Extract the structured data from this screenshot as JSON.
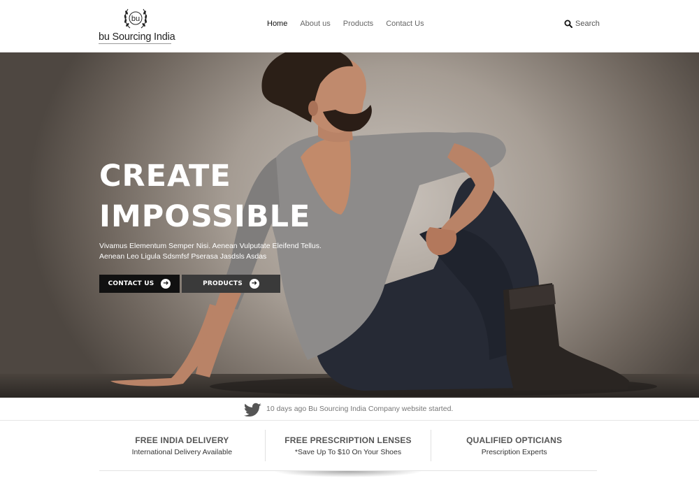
{
  "brand": {
    "emblem_text": "bu",
    "name": "bu Sourcing India"
  },
  "nav": {
    "items": [
      {
        "label": "Home",
        "active": true
      },
      {
        "label": "About us",
        "active": false
      },
      {
        "label": "Products",
        "active": false
      },
      {
        "label": "Contact Us",
        "active": false
      }
    ]
  },
  "search": {
    "label": "Search",
    "icon": "search-icon"
  },
  "hero": {
    "title_line1": "CREATE",
    "title_line2": "IMPOSSIBLE",
    "subtitle_line1": "Vivamus Elementum Semper Nisi. Aenean Vulputate Eleifend Tellus.",
    "subtitle_line2": "Aenean Leo Ligula Sdsmfsf Pserasa Jasdsls Asdas",
    "buttons": {
      "contact_label": "CONTACT US",
      "products_label": "PRODUCTS",
      "icon": "arrow-circle-right-icon"
    }
  },
  "tweet": {
    "icon": "twitter-bird-icon",
    "text": "10 days ago Bu Sourcing India Company website started."
  },
  "features": [
    {
      "title": "FREE INDIA DELIVERY",
      "subtitle": "International Delivery Available"
    },
    {
      "title": "FREE PRESCRIPTION LENSES",
      "subtitle": "*Save Up To $10 On Your Shoes"
    },
    {
      "title": "QUALIFIED OPTICIANS",
      "subtitle": "Prescription Experts"
    }
  ],
  "colors": {
    "button_primary": "#111111",
    "button_secondary": "#3a3a3a",
    "text_muted": "#777777"
  }
}
